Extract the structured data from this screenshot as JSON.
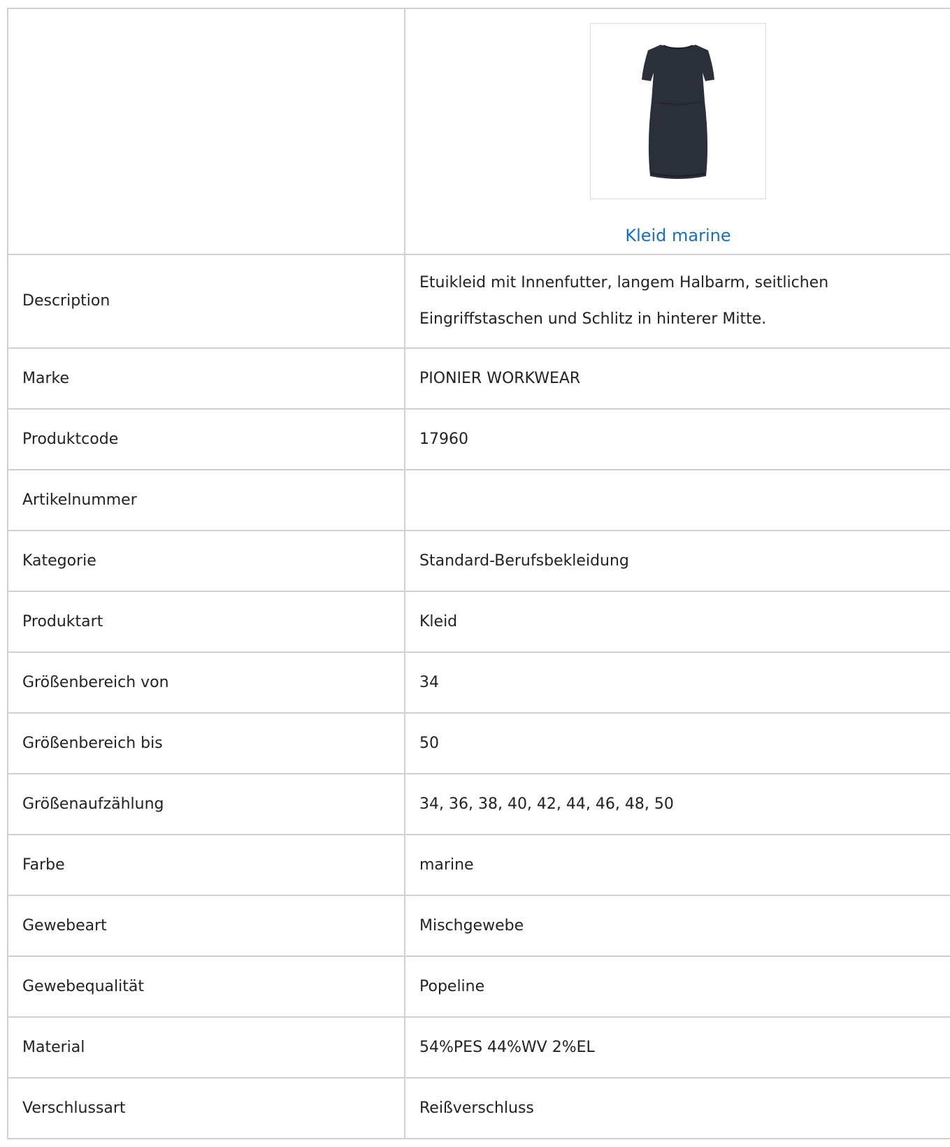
{
  "product": {
    "name": "Kleid marine",
    "image_icon": "dress-image"
  },
  "rows": [
    {
      "label": "Description",
      "value": "Etuikleid mit Innenfutter, langem Halbarm, seitlichen Eingriffstaschen und Schlitz in hinterer Mitte."
    },
    {
      "label": "Marke",
      "value": "PIONIER WORKWEAR"
    },
    {
      "label": "Produktcode",
      "value": "17960"
    },
    {
      "label": "Artikelnummer",
      "value": ""
    },
    {
      "label": "Kategorie",
      "value": "Standard-Berufsbekleidung"
    },
    {
      "label": "Produktart",
      "value": "Kleid"
    },
    {
      "label": "Größenbereich von",
      "value": "34"
    },
    {
      "label": "Größenbereich bis",
      "value": "50"
    },
    {
      "label": "Größenaufzählung",
      "value": "34, 36, 38, 40, 42, 44, 46, 48, 50"
    },
    {
      "label": "Farbe",
      "value": "marine"
    },
    {
      "label": "Gewebeart",
      "value": "Mischgewebe"
    },
    {
      "label": "Gewebequalität",
      "value": "Popeline"
    },
    {
      "label": "Material",
      "value": "54%PES 44%WV 2%EL"
    },
    {
      "label": "Verschlussart",
      "value": "Reißverschluss"
    }
  ],
  "colors": {
    "link": "#1a6fb5",
    "border": "#d0d0d0",
    "dress": "#2b2f3a"
  }
}
